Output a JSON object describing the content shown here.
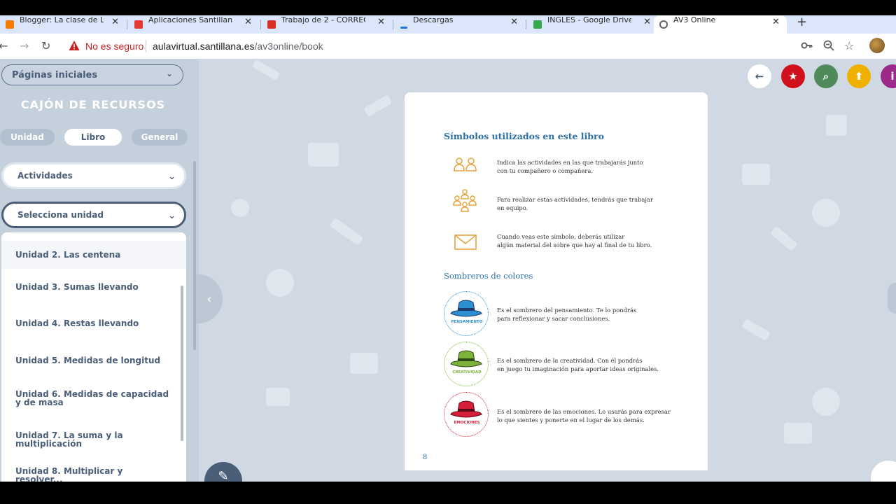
{
  "browser": {
    "tabs": [
      {
        "title": "Blogger: La clase de Lu...",
        "favicon_color": "#f57c00"
      },
      {
        "title": "Aplicaciones Santillana |",
        "favicon_color": "#e53935"
      },
      {
        "title": "Trabajo de 2 - CORREO...",
        "favicon_color": "#d93025"
      },
      {
        "title": "Descargas",
        "favicon_color": "#1a73e8"
      },
      {
        "title": "INGLES - Google Drive",
        "favicon_color": "#34a853"
      },
      {
        "title": "AV3 Online",
        "favicon_color": "#5f6368",
        "active": true
      }
    ],
    "new_tab": "+",
    "address": {
      "security_label": "No es seguro",
      "host": "aulavirtual.santillana.es",
      "path": "/av3online/book"
    }
  },
  "sidebar": {
    "pages_dropdown": "Páginas iniciales",
    "drawer_title": "CAJÓN DE RECURSOS",
    "filter_tabs": [
      "Unidad",
      "Libro",
      "General"
    ],
    "active_filter": "Libro",
    "activities_label": "Actividades",
    "unit_select_label": "Selecciona unidad",
    "units": [
      "Unidad 2. Las centena",
      "Unidad 3. Sumas llevando",
      "Unidad 4. Restas llevando",
      "Unidad 5. Medidas de longitud",
      "Unidad 6. Medidas de capacidad y de masa",
      "Unidad 7. La suma y la multiplicación",
      "Unidad 8. Multiplicar y resolver..."
    ]
  },
  "toolbar_buttons": [
    {
      "name": "back",
      "color": "#ffffff",
      "glyph": "←"
    },
    {
      "name": "favorites",
      "color": "#d0101a",
      "glyph": "★"
    },
    {
      "name": "search",
      "color": "#4e8a5a",
      "glyph": "⌕"
    },
    {
      "name": "upload",
      "color": "#f0b000",
      "glyph": "⬆"
    },
    {
      "name": "info",
      "color": "#9b2a8a",
      "glyph": "i"
    }
  ],
  "book_page": {
    "title": "Símbolos utilizados en este libro",
    "symbols": [
      {
        "icon": "pair-icon",
        "text_lines": [
          "Indica las actividades en las que trabajarás junto",
          "con tu compañero o compañera."
        ]
      },
      {
        "icon": "group-icon",
        "text_lines": [
          "Para realizar estas actividades, tendrás que trabajar",
          "en equipo."
        ]
      },
      {
        "icon": "envelope-icon",
        "text_lines": [
          "Cuando veas este símbolo, deberás utilizar",
          "algún material del sobre que hay al final de tu libro."
        ]
      }
    ],
    "hats_title": "Sombreros de colores",
    "hats": [
      {
        "label": "PENSAMIENTO",
        "color": "#2b8fd1",
        "text_lines": [
          "Es el sombrero del pensamiento. Te lo pondrás",
          "para reflexionar y sacar conclusiones."
        ]
      },
      {
        "label": "CREATIVIDAD",
        "color": "#7db33a",
        "text_lines": [
          "Es el sombrero de la creatividad. Con él pondrás",
          "en juego tu imaginación para aportar ideas originales."
        ]
      },
      {
        "label": "EMOCIONES",
        "color": "#d81f3a",
        "text_lines": [
          "Es el sombrero de las emociones. Lo usarás para expresar",
          "lo que sientes y ponerte en el lugar de los demás."
        ]
      }
    ],
    "page_number": "8"
  }
}
